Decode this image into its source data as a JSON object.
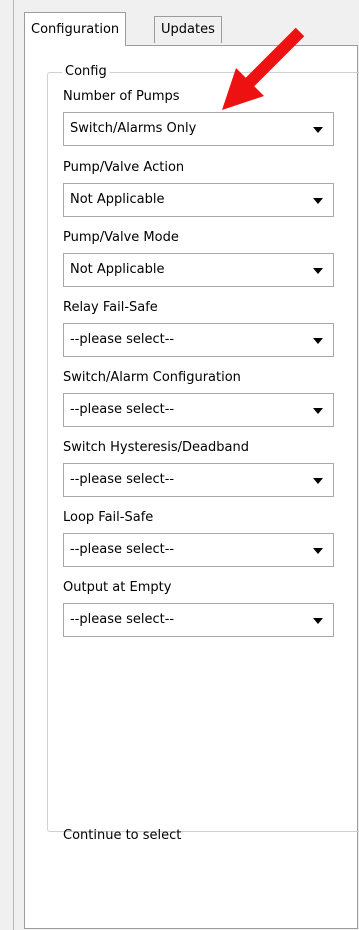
{
  "tabs": [
    {
      "label": "Configuration",
      "selected": true
    },
    {
      "label": "Updates",
      "selected": false
    }
  ],
  "group": {
    "legend": "Config"
  },
  "fields": [
    {
      "label": "Number of Pumps",
      "value": "Switch/Alarms Only"
    },
    {
      "label": "Pump/Valve Action",
      "value": "Not Applicable"
    },
    {
      "label": "Pump/Valve Mode",
      "value": "Not Applicable"
    },
    {
      "label": "Relay Fail-Safe",
      "value": "--please select--"
    },
    {
      "label": "Switch/Alarm Configuration",
      "value": "--please select--"
    },
    {
      "label": "Switch Hysteresis/Deadband",
      "value": "--please select--"
    },
    {
      "label": "Loop Fail-Safe",
      "value": "--please select--"
    },
    {
      "label": "Output at Empty",
      "value": "--please select--"
    }
  ],
  "footer_note": "Continue to select",
  "annotation": {
    "arrow_color": "#ee1111",
    "target": "Number of Pumps"
  }
}
